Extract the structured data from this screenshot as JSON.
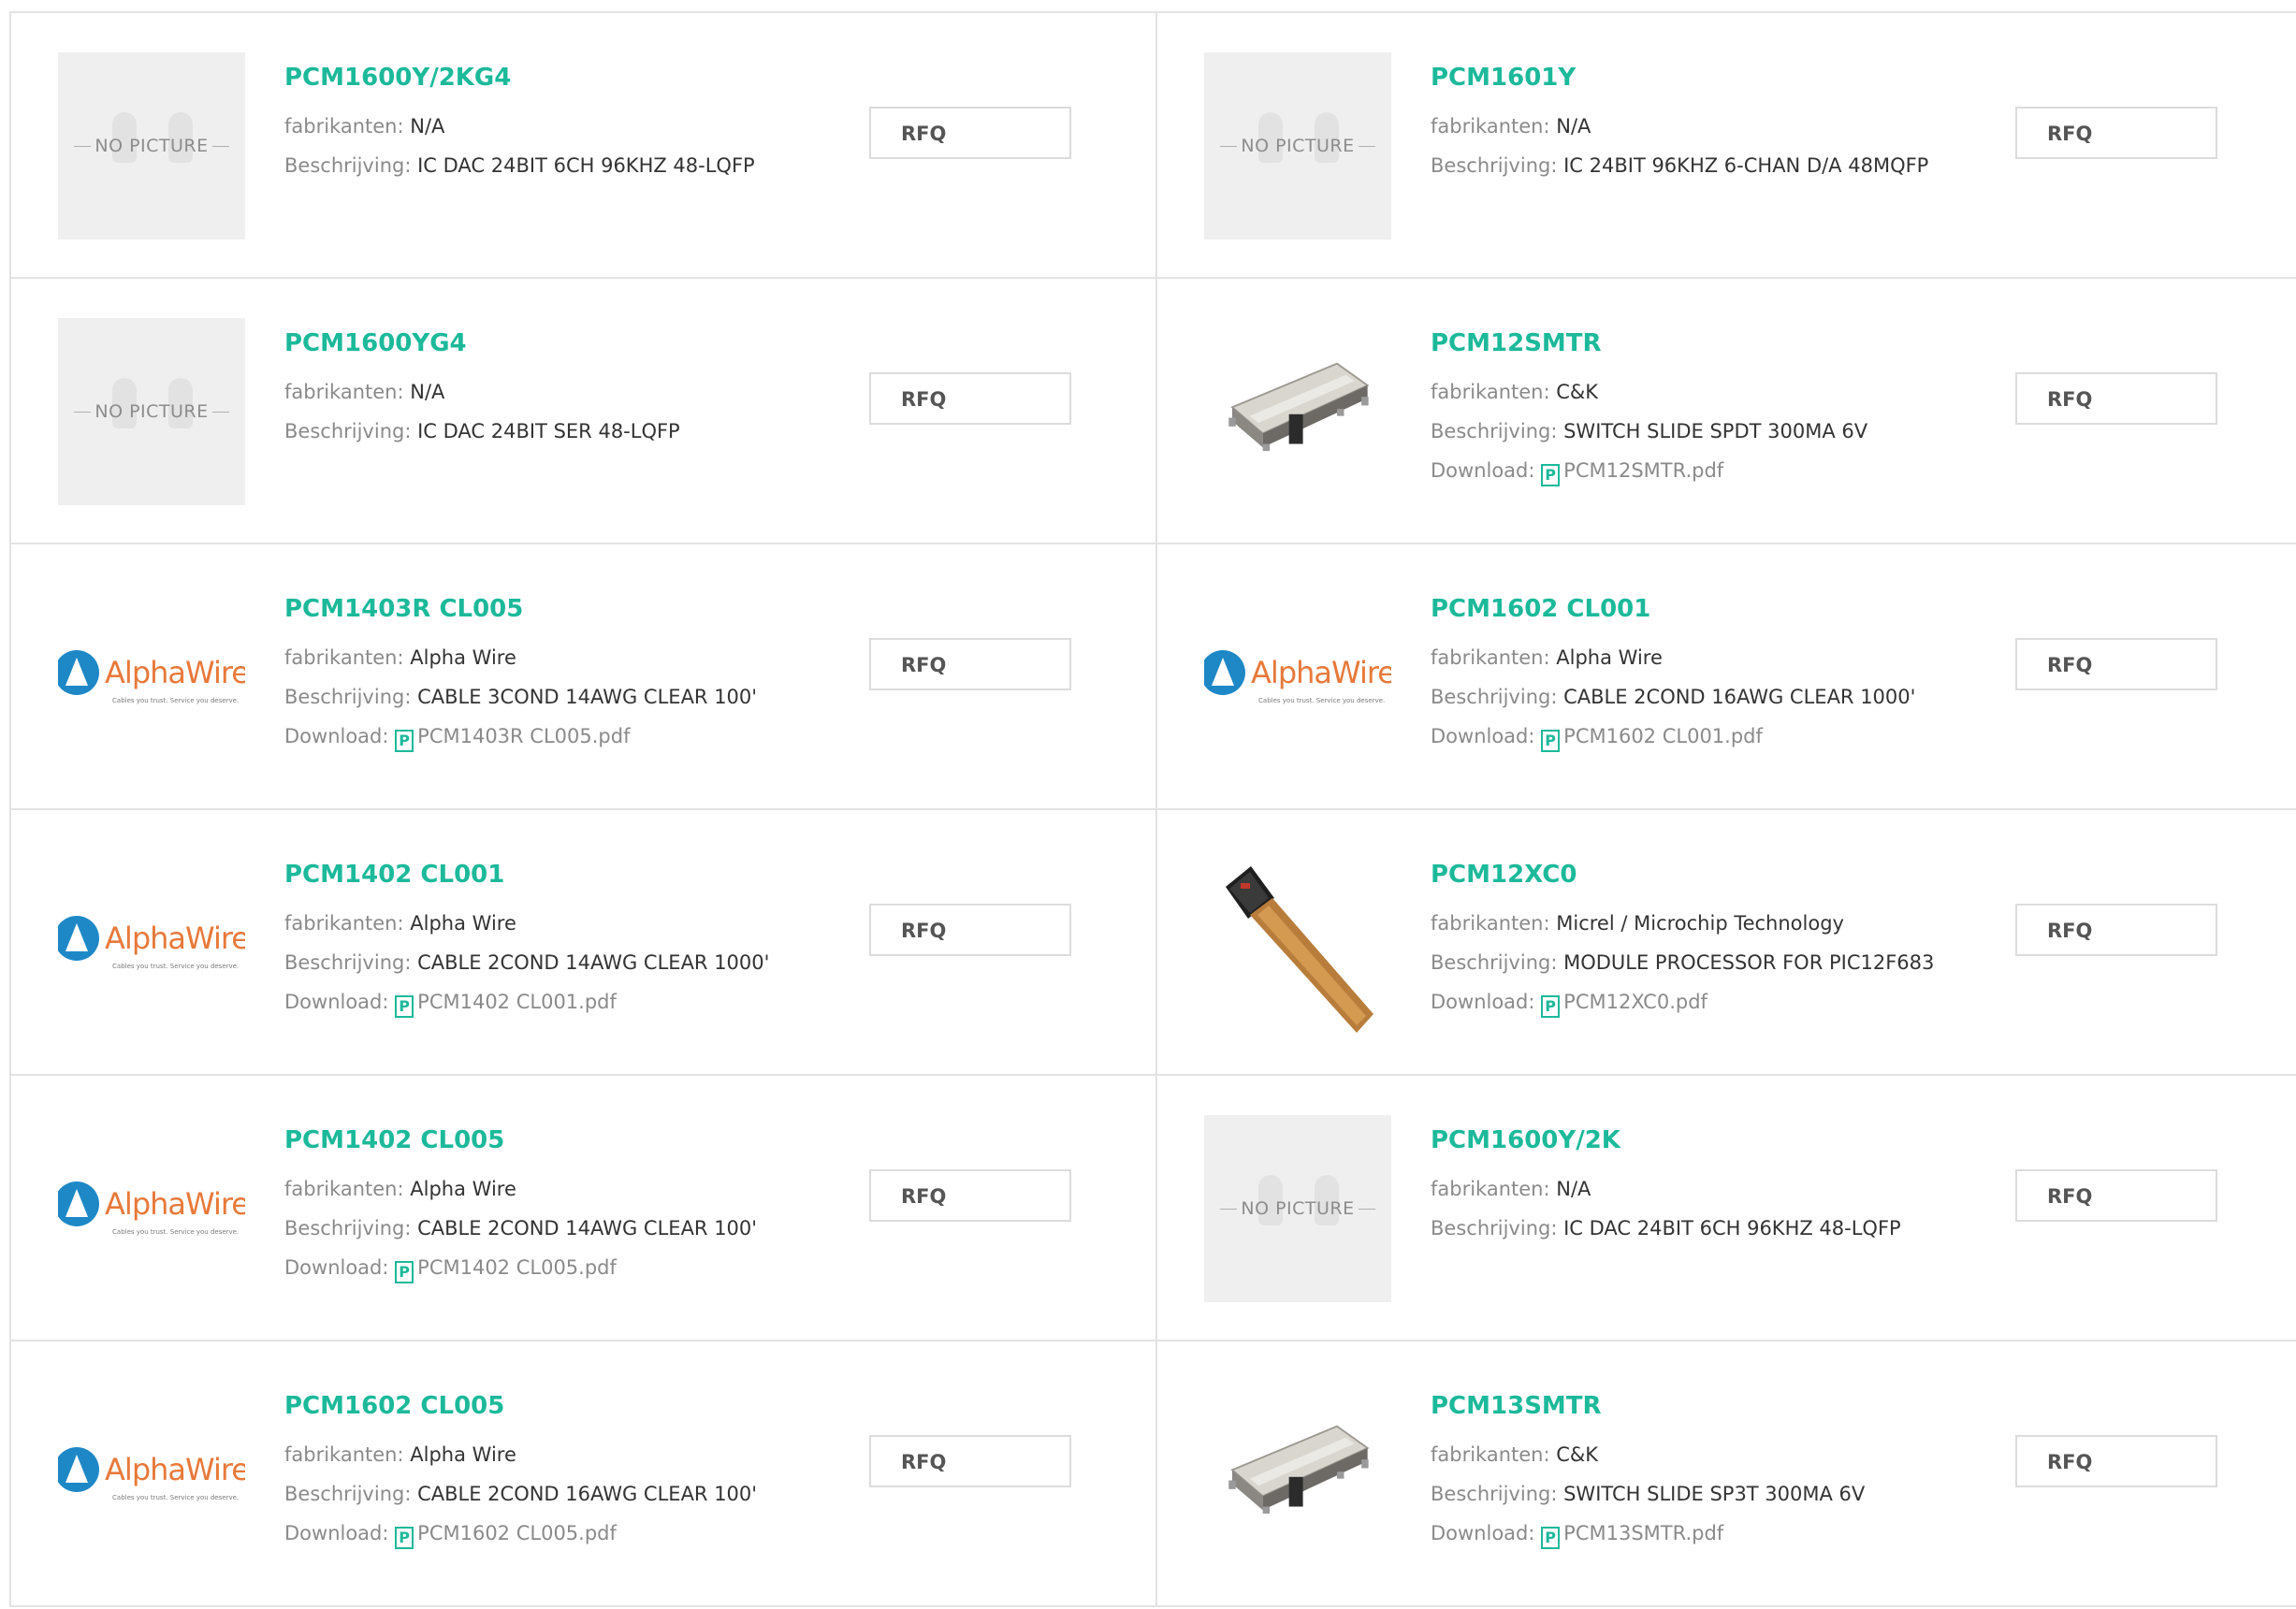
{
  "labels": {
    "manufacturer": "fabrikanten:",
    "description": "Beschrijving:",
    "download": "Download:",
    "rfq": "RFQ",
    "no_picture": "NO PICTURE",
    "alpha_wire_logo": "AlphaWire",
    "alpha_wire_tagline": "Cables you trust. Service you deserve."
  },
  "colors": {
    "accent": "#1cb99a",
    "border": "#e3e3e3",
    "label": "#8a8a8a",
    "text": "#333333"
  },
  "products": [
    {
      "part": "PCM1600Y/2KG4",
      "manufacturer": "N/A",
      "description": "IC DAC 24BIT 6CH 96KHZ 48-LQFP",
      "download": "",
      "image": "no-picture"
    },
    {
      "part": "PCM1601Y",
      "manufacturer": "N/A",
      "description": "IC 24BIT 96KHZ 6-CHAN D/A 48MQFP",
      "download": "",
      "image": "no-picture"
    },
    {
      "part": "PCM1600YG4",
      "manufacturer": "N/A",
      "description": "IC DAC 24BIT SER 48-LQFP",
      "download": "",
      "image": "no-picture"
    },
    {
      "part": "PCM12SMTR",
      "manufacturer": "C&K",
      "description": "SWITCH SLIDE SPDT 300MA 6V",
      "download": "PCM12SMTR.pdf",
      "image": "slide-switch"
    },
    {
      "part": "PCM1403R CL005",
      "manufacturer": "Alpha Wire",
      "description": "CABLE 3COND 14AWG CLEAR 100'",
      "download": "PCM1403R CL005.pdf",
      "image": "alpha-wire-logo"
    },
    {
      "part": "PCM1602 CL001",
      "manufacturer": "Alpha Wire",
      "description": "CABLE 2COND 16AWG CLEAR 1000'",
      "download": "PCM1602 CL001.pdf",
      "image": "alpha-wire-logo"
    },
    {
      "part": "PCM1402 CL001",
      "manufacturer": "Alpha Wire",
      "description": "CABLE 2COND 14AWG CLEAR 1000'",
      "download": "PCM1402 CL001.pdf",
      "image": "alpha-wire-logo"
    },
    {
      "part": "PCM12XC0",
      "manufacturer": "Micrel / Microchip Technology",
      "description": "MODULE PROCESSOR FOR PIC12F683",
      "download": "PCM12XC0.pdf",
      "image": "flex-module"
    },
    {
      "part": "PCM1402 CL005",
      "manufacturer": "Alpha Wire",
      "description": "CABLE 2COND 14AWG CLEAR 100'",
      "download": "PCM1402 CL005.pdf",
      "image": "alpha-wire-logo"
    },
    {
      "part": "PCM1600Y/2K",
      "manufacturer": "N/A",
      "description": "IC DAC 24BIT 6CH 96KHZ 48-LQFP",
      "download": "",
      "image": "no-picture"
    },
    {
      "part": "PCM1602 CL005",
      "manufacturer": "Alpha Wire",
      "description": "CABLE 2COND 16AWG CLEAR 100'",
      "download": "PCM1602 CL005.pdf",
      "image": "alpha-wire-logo"
    },
    {
      "part": "PCM13SMTR",
      "manufacturer": "C&K",
      "description": "SWITCH SLIDE SP3T 300MA 6V",
      "download": "PCM13SMTR.pdf",
      "image": "slide-switch"
    }
  ]
}
